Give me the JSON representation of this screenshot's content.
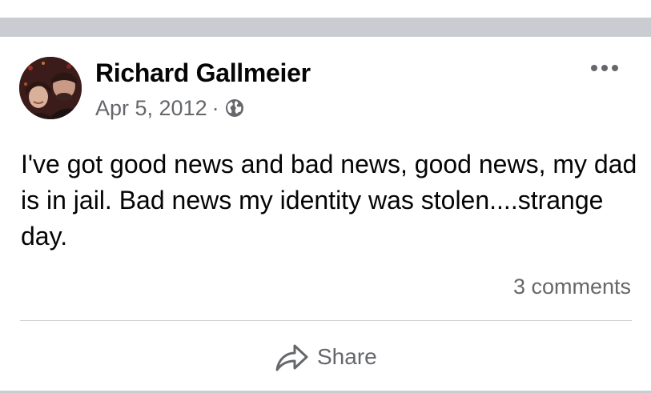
{
  "post": {
    "author": "Richard Gallmeier",
    "date": "Apr 5, 2012",
    "separator": "·",
    "privacy_icon": "globe-icon",
    "more_icon": "more-options-icon",
    "text": "I've got good news and bad news, good news, my dad is in jail. Bad news my identity was stolen....strange day.",
    "comments_label": "3 comments",
    "share_label": "Share",
    "share_icon": "share-arrow-icon"
  },
  "colors": {
    "separator_gray": "#c9ccd1",
    "text_primary": "#050505",
    "text_secondary": "#65676b",
    "divider": "#ced0d4"
  }
}
